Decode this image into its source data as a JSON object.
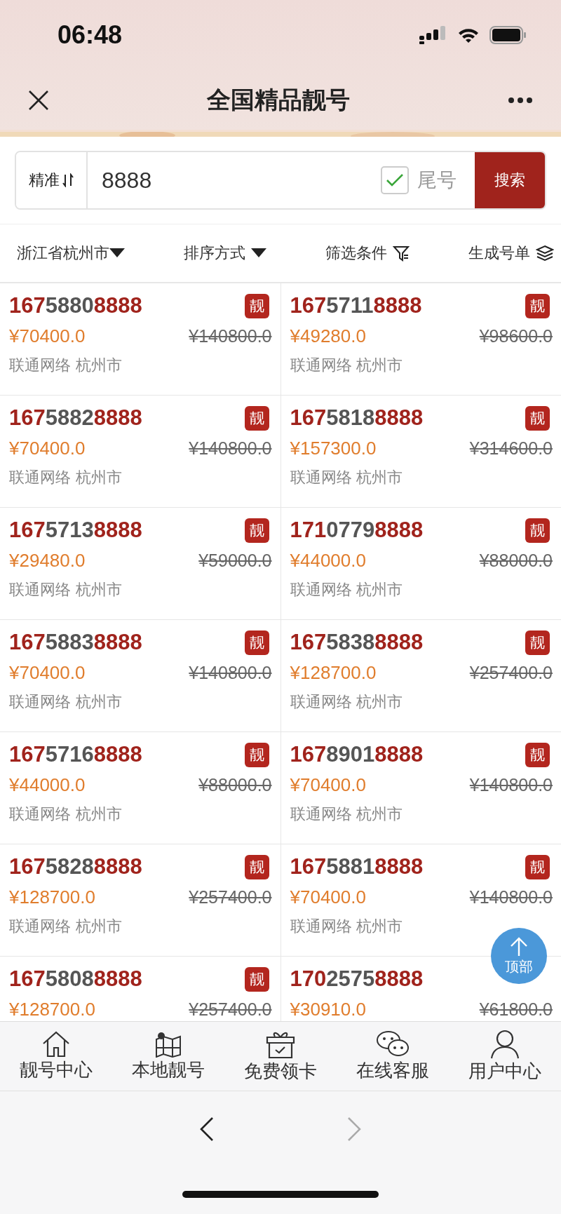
{
  "status_bar": {
    "time": "06:48"
  },
  "header": {
    "title": "全国精品靓号"
  },
  "search": {
    "mode": "精准",
    "value": "8888",
    "tail_only": {
      "label": "尾号",
      "checked": true
    },
    "button": "搜索"
  },
  "filters": [
    {
      "label": "浙江省杭州市",
      "kind": "dropdown"
    },
    {
      "label": "排序方式",
      "kind": "dropdown"
    },
    {
      "label": "筛选条件",
      "kind": "filter"
    },
    {
      "label": "生成号单",
      "kind": "layers"
    }
  ],
  "numbers": [
    {
      "number": "16758808888",
      "badge": "靓",
      "price": "¥70400.0",
      "original_price": "¥140800.0",
      "location": "联通网络 杭州市"
    },
    {
      "number": "16757118888",
      "badge": "靓",
      "price": "¥49280.0",
      "original_price": "¥98600.0",
      "location": "联通网络 杭州市"
    },
    {
      "number": "16758828888",
      "badge": "靓",
      "price": "¥70400.0",
      "original_price": "¥140800.0",
      "location": "联通网络 杭州市"
    },
    {
      "number": "16758188888",
      "badge": "靓",
      "price": "¥157300.0",
      "original_price": "¥314600.0",
      "location": "联通网络 杭州市"
    },
    {
      "number": "16757138888",
      "badge": "靓",
      "price": "¥29480.0",
      "original_price": "¥59000.0",
      "location": "联通网络 杭州市"
    },
    {
      "number": "17107798888",
      "badge": "靓",
      "price": "¥44000.0",
      "original_price": "¥88000.0",
      "location": "联通网络 杭州市"
    },
    {
      "number": "16758838888",
      "badge": "靓",
      "price": "¥70400.0",
      "original_price": "¥140800.0",
      "location": "联通网络 杭州市"
    },
    {
      "number": "16758388888",
      "badge": "靓",
      "price": "¥128700.0",
      "original_price": "¥257400.0",
      "location": "联通网络 杭州市"
    },
    {
      "number": "16757168888",
      "badge": "靓",
      "price": "¥44000.0",
      "original_price": "¥88000.0",
      "location": "联通网络 杭州市"
    },
    {
      "number": "16789018888",
      "badge": "靓",
      "price": "¥70400.0",
      "original_price": "¥140800.0",
      "location": "联通网络 杭州市"
    },
    {
      "number": "16758288888",
      "badge": "靓",
      "price": "¥128700.0",
      "original_price": "¥257400.0",
      "location": "联通网络 杭州市"
    },
    {
      "number": "16758818888",
      "badge": "靓",
      "price": "¥70400.0",
      "original_price": "¥140800.0",
      "location": "联通网络 杭州市"
    },
    {
      "number": "16758088888",
      "badge": "靓",
      "price": "¥128700.0",
      "original_price": "¥257400.0"
    },
    {
      "number": "17025758888",
      "price": "¥30910.0",
      "original_price": "¥61800.0"
    }
  ],
  "back_to_top": "顶部",
  "tab_bar": [
    {
      "label": "靓号中心",
      "kind": "home"
    },
    {
      "label": "本地靓号",
      "kind": "map"
    },
    {
      "label": "免费领卡",
      "kind": "gift"
    },
    {
      "label": "在线客服",
      "kind": "chat"
    },
    {
      "label": "用户中心",
      "kind": "user"
    }
  ]
}
